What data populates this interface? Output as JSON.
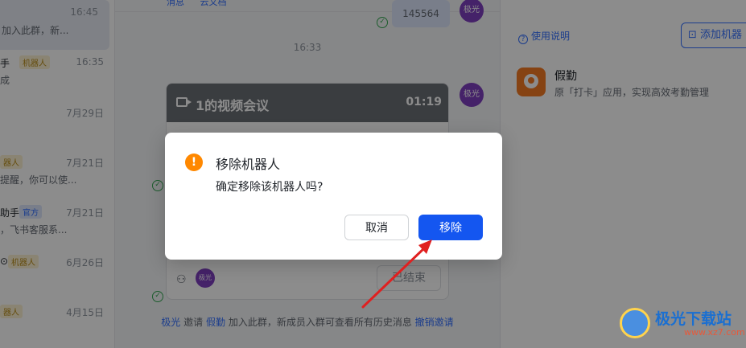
{
  "conversations": [
    {
      "name": "",
      "tag": "",
      "time": "16:45",
      "preview": "加入此群，新...",
      "selected": true
    },
    {
      "name": "手",
      "tag": "机器人",
      "time": "16:35",
      "preview": "成"
    },
    {
      "name": "",
      "tag": "",
      "time": "7月29日",
      "preview": ""
    },
    {
      "name": "",
      "tag": "器人",
      "time": "7月21日",
      "preview": "提醒，你可以使..."
    },
    {
      "name": "助手",
      "tag": "官方",
      "time": "7月21日",
      "preview": "，飞书客服系..."
    },
    {
      "name": "⊙",
      "tag": "机器人",
      "time": "6月26日",
      "preview": ""
    },
    {
      "name": "",
      "tag": "器人",
      "time": "4月15日",
      "preview": ""
    }
  ],
  "chat": {
    "top_tabs": [
      "消息",
      "云文档"
    ],
    "msg_bubble": "145564",
    "time_divider": "16:33",
    "avatar_text": "极光",
    "video_card": {
      "title": "1的视频会议",
      "duration": "01:19",
      "ended_label": "已结束",
      "avatar_text": "极光"
    },
    "system_msg": {
      "inviter": "极光",
      "t1": "邀请",
      "invitee": "假勤",
      "t2": "加入此群，新成员入群可查看所有历史消息",
      "undo": "撤销邀请"
    }
  },
  "right_panel": {
    "usage_link": "使用说明",
    "add_bot_button": "添加机器",
    "app": {
      "name": "假勤",
      "desc": "原「打卡」应用，实现高效考勤管理"
    }
  },
  "dialog": {
    "title": "移除机器人",
    "message": "确定移除该机器人吗?",
    "cancel_label": "取消",
    "confirm_label": "移除"
  },
  "watermark": {
    "line1": "极光下载站",
    "line2": "www.xz7.com"
  },
  "colors": {
    "primary": "#1456f0",
    "link": "#3370ff",
    "warning": "#ff8800",
    "annotation_arrow": "#e02020"
  }
}
